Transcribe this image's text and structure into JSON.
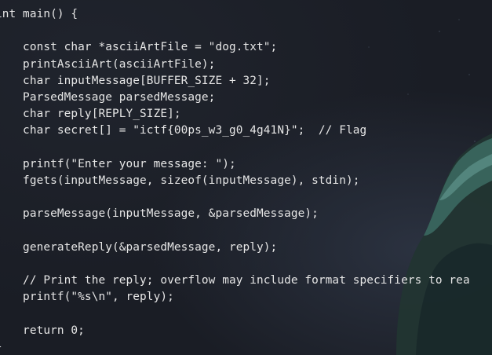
{
  "editor": {
    "lines": [
      "int main() {",
      "",
      "    const char *asciiArtFile = \"dog.txt\";",
      "    printAsciiArt(asciiArtFile);",
      "    char inputMessage[BUFFER_SIZE + 32];",
      "    ParsedMessage parsedMessage;",
      "    char reply[REPLY_SIZE];",
      "    char secret[] = \"ictf{00ps_w3_g0_4g41N}\";  // Flag",
      "",
      "    printf(\"Enter your message: \");",
      "    fgets(inputMessage, sizeof(inputMessage), stdin);",
      "",
      "    parseMessage(inputMessage, &parsedMessage);",
      "",
      "    generateReply(&parsedMessage, reply);",
      "",
      "    // Print the reply; overflow may include format specifiers to rea",
      "    printf(\"%s\\n\", reply);",
      "",
      "    return 0;",
      "}"
    ]
  },
  "theme": {
    "background": "#1a1d25",
    "text": "#e6e6e6",
    "accent_art": "#2f5a55"
  }
}
